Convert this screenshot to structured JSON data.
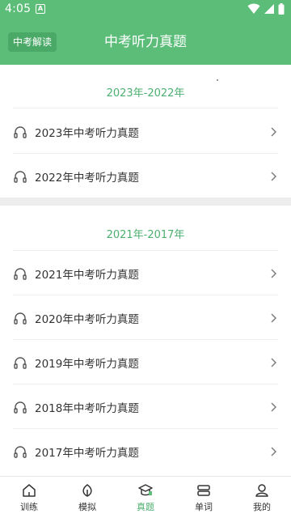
{
  "status_bar": {
    "time": "4:05",
    "a_icon": "A"
  },
  "header": {
    "badge_label": "中考解读",
    "title": "中考听力真题",
    "background": "#5bbd78"
  },
  "sections": [
    {
      "title": "2023年-2022年",
      "items": [
        {
          "label": "2023年中考听力真题",
          "icon": "headphones-icon"
        },
        {
          "label": "2022年中考听力真题",
          "icon": "headphones-icon"
        }
      ]
    },
    {
      "title": "2021年-2017年",
      "items": [
        {
          "label": "2021年中考听力真题",
          "icon": "headphones-icon"
        },
        {
          "label": "2020年中考听力真题",
          "icon": "headphones-icon"
        },
        {
          "label": "2019年中考听力真题",
          "icon": "headphones-icon"
        },
        {
          "label": "2018年中考听力真题",
          "icon": "headphones-icon"
        },
        {
          "label": "2017年中考听力真题",
          "icon": "headphones-icon"
        }
      ]
    }
  ],
  "tabbar": {
    "active": "真题",
    "accent": "#4caf6e",
    "tabs": [
      {
        "label": "训练",
        "icon": "home-icon"
      },
      {
        "label": "模拟",
        "icon": "leaf-icon"
      },
      {
        "label": "真题",
        "icon": "graduation-cap-icon"
      },
      {
        "label": "单词",
        "icon": "book-icon"
      },
      {
        "label": "我的",
        "icon": "person-icon"
      }
    ]
  }
}
